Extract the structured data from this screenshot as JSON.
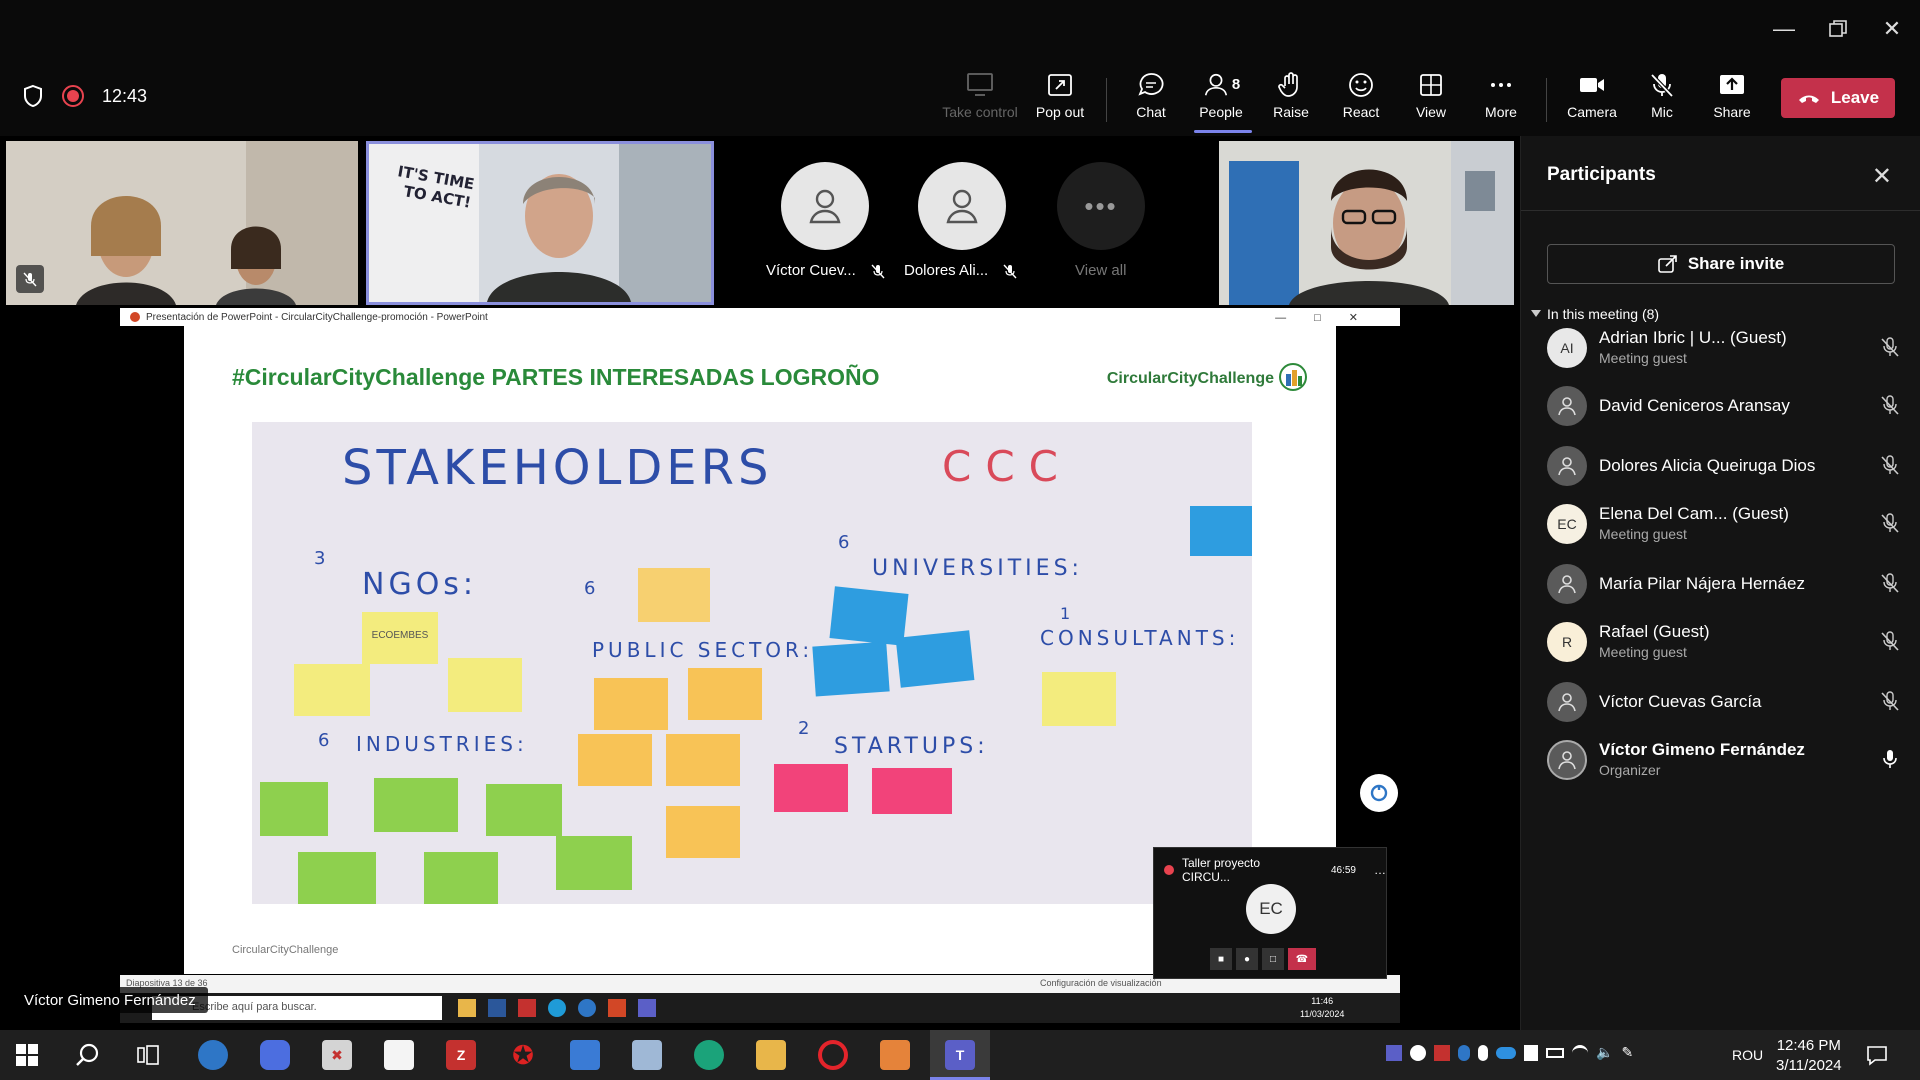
{
  "meeting": {
    "timer": "12:43"
  },
  "toolbar": {
    "take_control": "Take control",
    "pop_out": "Pop out",
    "chat": "Chat",
    "people": "People",
    "people_count": "8",
    "raise": "Raise",
    "react": "React",
    "view": "View",
    "more": "More",
    "camera": "Camera",
    "mic": "Mic",
    "share": "Share",
    "leave": "Leave"
  },
  "video_strip": {
    "avatar1_name": "Víctor Cuev...",
    "avatar2_name": "Dolores Ali...",
    "view_all": "View all"
  },
  "presentation": {
    "window_title": "Presentación de PowerPoint  -  CircularCityChallenge-promoción  -  PowerPoint",
    "slide_title": "#CircularCityChallenge PARTES INTERESADAS LOGROÑO",
    "brand": "CircularCityChallenge",
    "footer": "CircularCityChallenge",
    "board": {
      "heading": "STAKEHOLDERS",
      "ccc": "CCC",
      "ngos": "NGOs:",
      "public_sector": "PUBLIC SECTOR:",
      "universities": "UNIVERSITIES:",
      "consultants": "CONSULTANTS:",
      "industries": "INDUSTRIES:",
      "startups": "STARTUPS:",
      "n3": "3",
      "n6a": "6",
      "n6b": "6",
      "n6c": "6",
      "n1": "1",
      "n2": "2",
      "note_ecoembes": "ECOEMBES"
    },
    "status_left": "Diapositiva 13 de 36",
    "status_right": "Configuración de visualización",
    "search_placeholder": "Escribe aquí para buscar.",
    "inner_clock_time": "11:46",
    "inner_clock_date": "11/03/2024"
  },
  "mini_call": {
    "title": "Taller proyecto CIRCU...",
    "time": "46:59",
    "initials": "EC"
  },
  "speaker_name": "Víctor Gimeno Fernández",
  "participants": {
    "title": "Participants",
    "share_invite": "Share invite",
    "section": "In this meeting (8)",
    "list": [
      {
        "initials": "AI",
        "name": "Adrian Ibric | U... (Guest)",
        "sub": "Meeting guest",
        "avatar_color": "#e8e8e8"
      },
      {
        "initials": "",
        "name": "David Ceniceros Aransay",
        "sub": "",
        "avatar_color": "#5a5a5a"
      },
      {
        "initials": "",
        "name": "Dolores Alicia Queiruga Dios",
        "sub": "",
        "avatar_color": "#5a5a5a"
      },
      {
        "initials": "EC",
        "name": "Elena Del Cam... (Guest)",
        "sub": "Meeting guest",
        "avatar_color": "#f6f0e2"
      },
      {
        "initials": "",
        "name": "María Pilar Nájera Hernáez",
        "sub": "",
        "avatar_color": "#5a5a5a"
      },
      {
        "initials": "R",
        "name": "Rafael (Guest)",
        "sub": "Meeting guest",
        "avatar_color": "#f9efd8"
      },
      {
        "initials": "",
        "name": "Víctor Cuevas García",
        "sub": "",
        "avatar_color": "#5a5a5a"
      },
      {
        "initials": "",
        "name": "Víctor Gimeno Fernández",
        "sub": "Organizer",
        "avatar_color": "#5a5a5a"
      }
    ]
  },
  "taskbar": {
    "language": "ROU",
    "time": "12:46 PM",
    "date": "3/11/2024"
  }
}
